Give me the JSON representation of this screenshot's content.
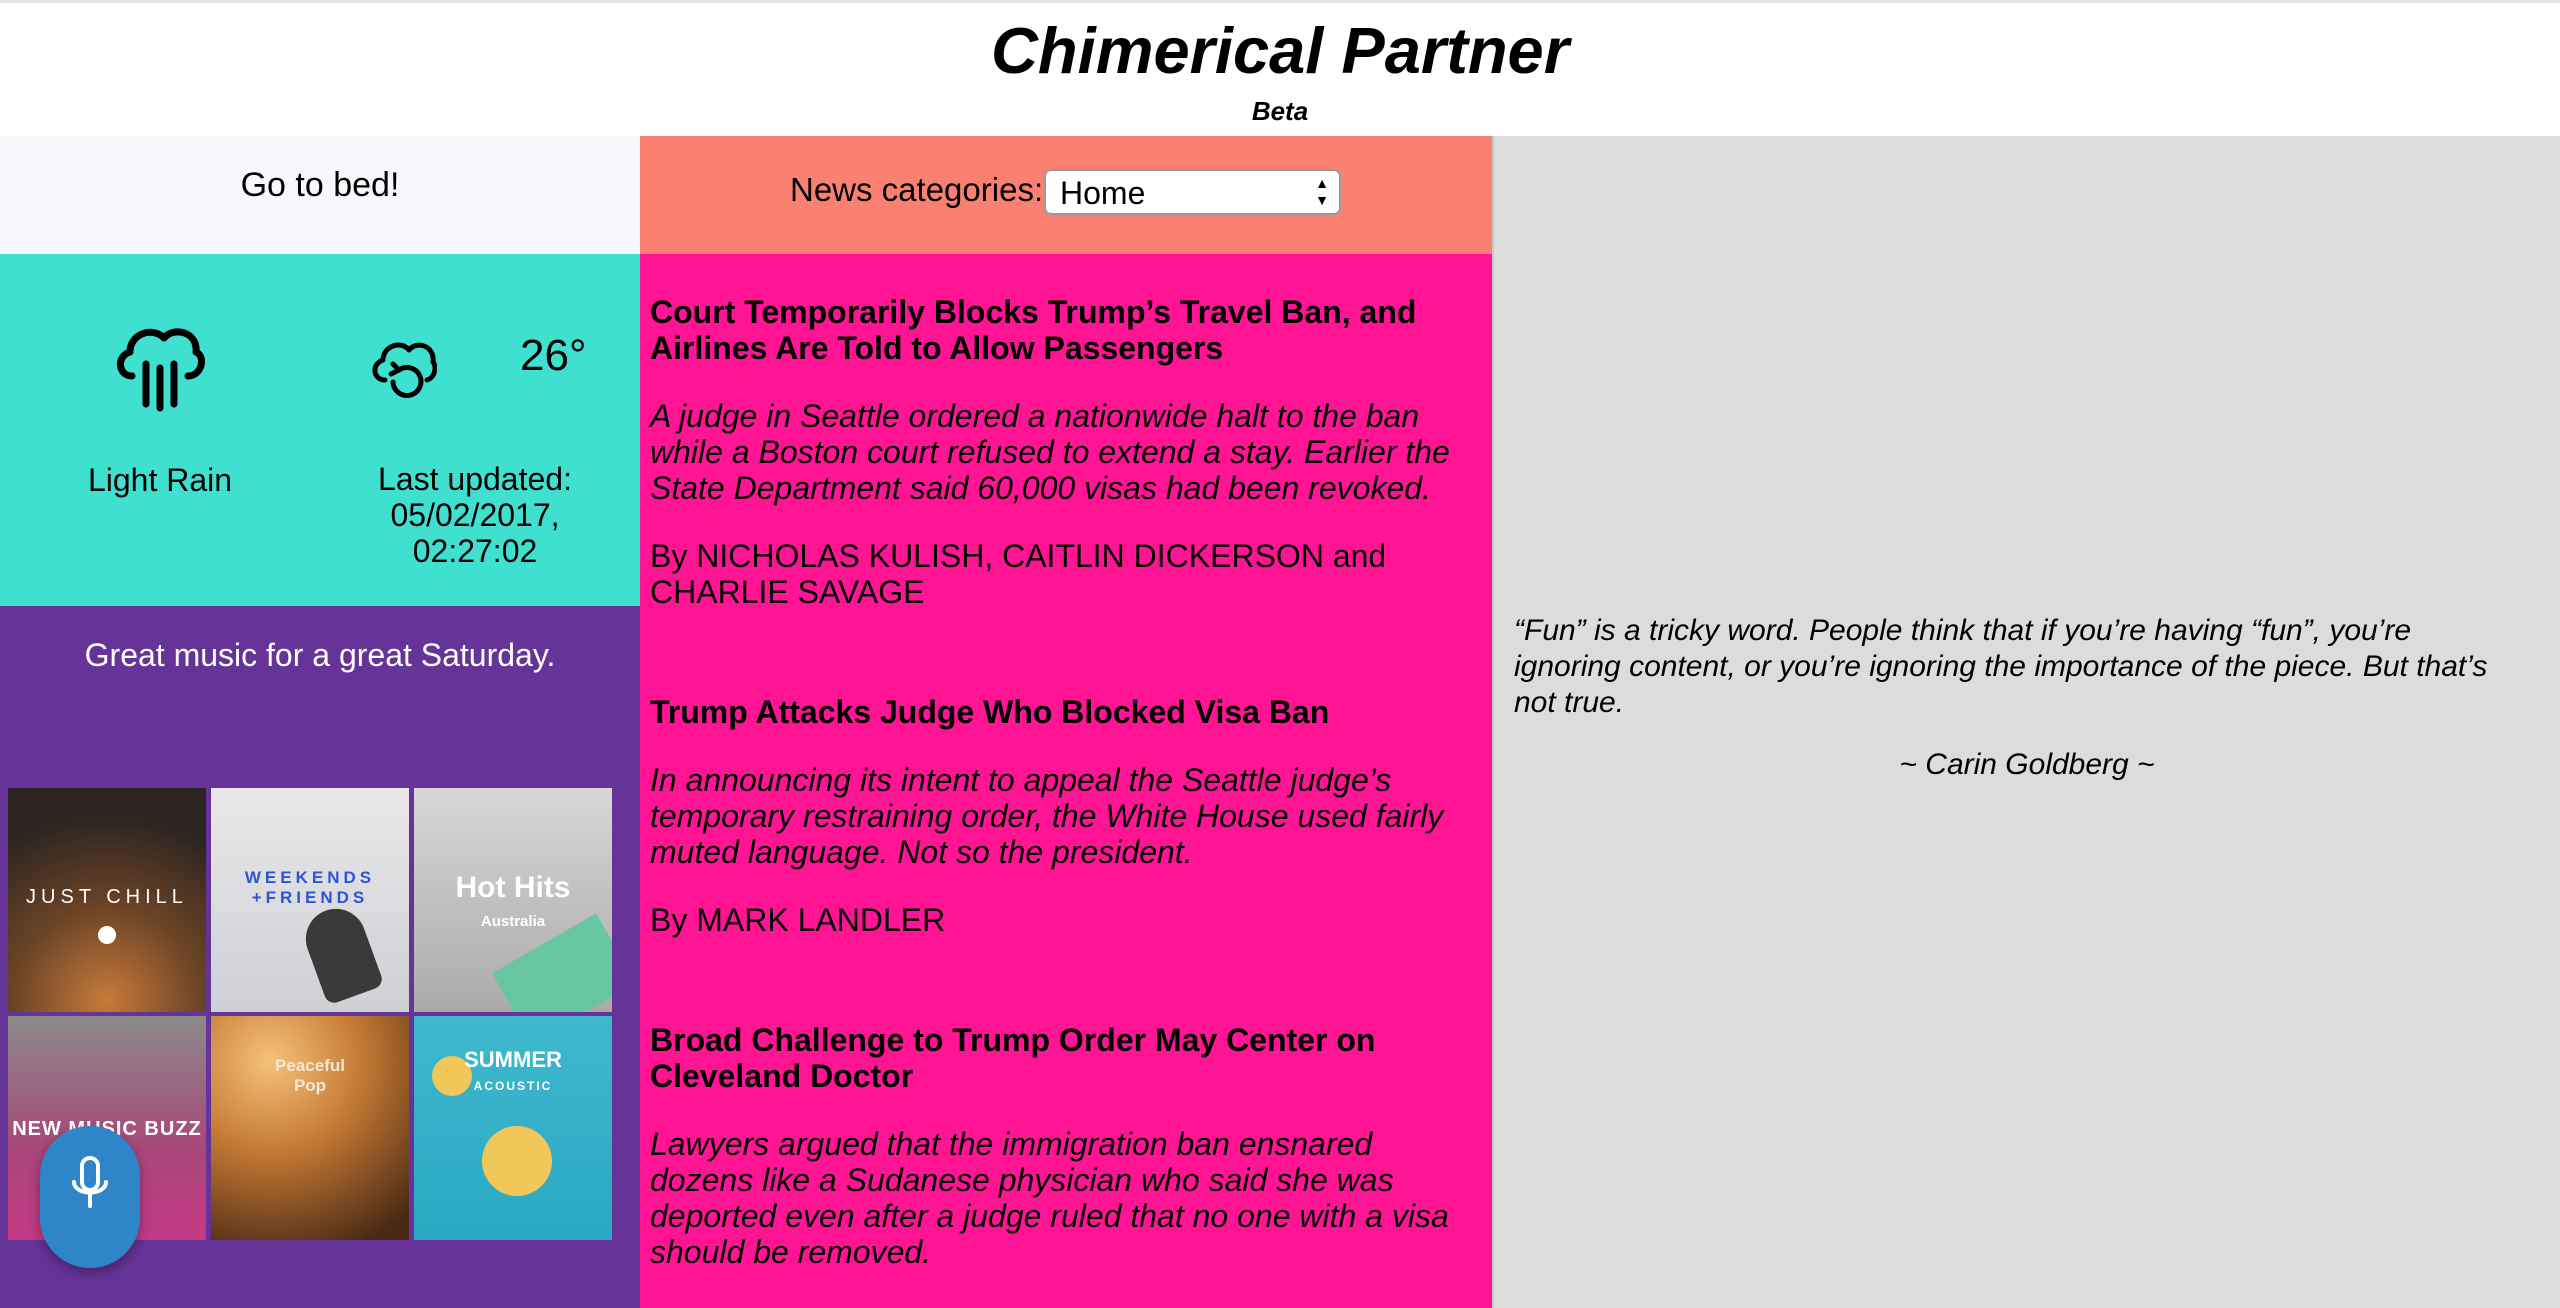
{
  "app": {
    "title": "Chimerical Partner",
    "subtitle": "Beta"
  },
  "todo": {
    "message": "Go to bed!"
  },
  "weather": {
    "condition": "Light Rain",
    "temperature": "26°",
    "last_updated_label": "Last updated:",
    "last_updated_date": "05/02/2017,",
    "last_updated_time": "02:27:02",
    "condition_icon": "rain-cloud-icon",
    "refresh_icon": "cloud-refresh-icon"
  },
  "music": {
    "greeting": "Great music for a great Saturday.",
    "playlists": [
      {
        "label": "JUST CHILL",
        "sublabel": ""
      },
      {
        "label": "WEEKENDS\n+FRIENDS",
        "sublabel": ""
      },
      {
        "label": "Hot Hits",
        "sublabel": "Australia"
      },
      {
        "label": "NEW MUSIC BUZZ",
        "sublabel": ""
      },
      {
        "label": "Peaceful\nPop",
        "sublabel": ""
      },
      {
        "label": "SUMMER",
        "sublabel": "ACOUSTIC"
      }
    ]
  },
  "news": {
    "category_label": "News categories:",
    "selected_category": "Home",
    "articles": [
      {
        "headline": "Court Temporarily Blocks Trump’s Travel Ban, and Airlines Are Told to Allow Passengers",
        "abstract": "A judge in Seattle ordered a nationwide halt to the ban while a Boston court refused to extend a stay. Earlier the State Department said 60,000 visas had been revoked.",
        "byline": "By NICHOLAS KULISH, CAITLIN DICKERSON and CHARLIE SAVAGE"
      },
      {
        "headline": "Trump Attacks Judge Who Blocked Visa Ban",
        "abstract": "In announcing its intent to appeal the Seattle judge’s temporary restraining order, the White House used fairly muted language. Not so the president.",
        "byline": "By MARK LANDLER"
      },
      {
        "headline": "Broad Challenge to Trump Order May Center on Cleveland Doctor",
        "abstract": "Lawyers argued that the immigration ban ensnared dozens like a Sudanese physician who said she was deported even after a judge ruled that no one with a visa should be removed.",
        "byline": ""
      }
    ]
  },
  "quote": {
    "text": "“Fun” is a tricky word. People think that if you’re having “fun”, you’re ignoring content, or you’re ignoring the importance of the piece. But that’s not true.",
    "author": "~ Carin Goldberg ~"
  },
  "colors": {
    "todo_bg": "#f7f8fc",
    "weather_bg": "#40e0d0",
    "music_bg": "#663399",
    "newsbar_bg": "#fa8072",
    "news_bg": "#ff1493",
    "quote_bg": "#dcdcdc",
    "mic_button": "#2e86c9"
  },
  "mic": {
    "icon": "microphone-icon"
  }
}
